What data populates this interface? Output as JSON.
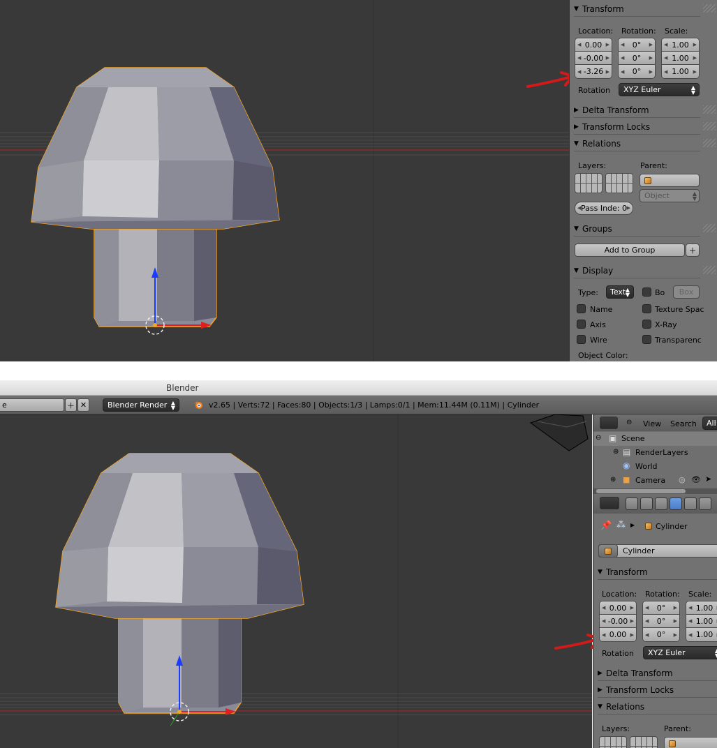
{
  "top": {
    "transform": {
      "title": "Transform",
      "location_label": "Location:",
      "rotation_label": "Rotation:",
      "scale_label": "Scale:",
      "location": [
        "0.00",
        "-0.00",
        "-3.26"
      ],
      "rotation": [
        "0°",
        "0°",
        "0°"
      ],
      "scale": [
        "1.00",
        "1.00",
        "1.00"
      ],
      "rotation_mode_label": "Rotation",
      "rotation_mode": "XYZ Euler"
    },
    "sections": [
      "Delta Transform",
      "Transform Locks",
      "Relations"
    ],
    "relations": {
      "layers_label": "Layers:",
      "parent_label": "Parent:",
      "parent_type": "Object",
      "pass_index": "Pass Inde: 0"
    },
    "groups": {
      "title": "Groups",
      "add_button": "Add to Group"
    },
    "display": {
      "title": "Display",
      "type_label": "Type:",
      "type_value": "Text",
      "bounds_label": "Bo",
      "bounds_value": "Box",
      "checks": [
        "Name",
        "Axis",
        "Wire"
      ],
      "checks_right": [
        "Texture Spac",
        "X-Ray",
        "Transparenc"
      ],
      "object_color": "Object Color:"
    }
  },
  "bottom": {
    "window_title": "Blender",
    "scene_field": "e",
    "render_engine": "Blender Render",
    "stats": "v2.65 | Verts:72 | Faces:80 | Objects:1/3 | Lamps:0/1 | Mem:11.44M (0.11M) | Cylinder",
    "outliner": {
      "view": "View",
      "search": "Search",
      "all": "All",
      "items": [
        "Scene",
        "RenderLayers",
        "World",
        "Camera"
      ]
    },
    "breadcrumb_object": "Cylinder",
    "object_name": "Cylinder",
    "transform": {
      "title": "Transform",
      "location_label": "Location:",
      "rotation_label": "Rotation:",
      "scale_label": "Scale:",
      "location": [
        "0.00",
        "-0.00",
        "0.00"
      ],
      "rotation": [
        "0°",
        "0°",
        "0°"
      ],
      "scale": [
        "1.00",
        "1.00",
        "1.00"
      ],
      "rotation_mode_label": "Rotation",
      "rotation_mode": "XYZ Euler"
    },
    "sections": [
      "Delta Transform",
      "Transform Locks",
      "Relations"
    ],
    "relations": {
      "layers_label": "Layers:",
      "parent_label": "Parent:"
    }
  },
  "colors": {
    "viewport_bg": "#393939",
    "panel_bg": "#727272",
    "selection_outline": "#f5a623",
    "annotation_arrow": "#d11a1a",
    "axis_z": "#1a3cff",
    "axis_x": "#e01f1f"
  }
}
